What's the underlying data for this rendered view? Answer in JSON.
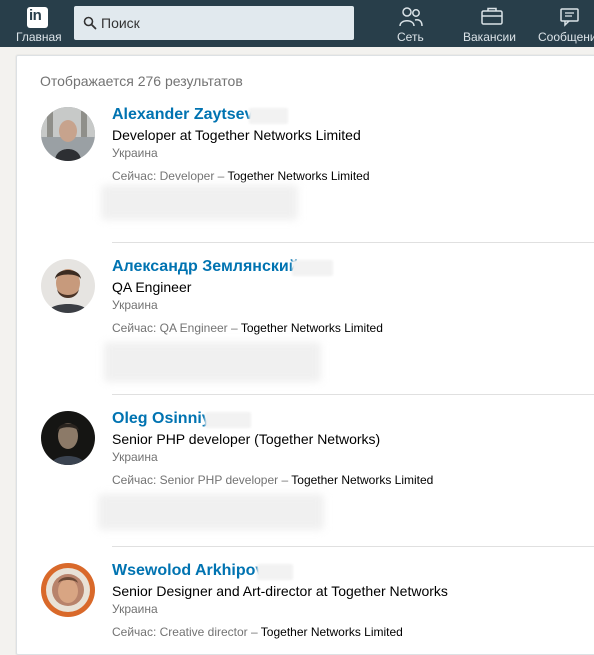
{
  "nav": {
    "home_label": "Главная",
    "network_label": "Сеть",
    "jobs_label": "Вакансии",
    "messages_label": "Сообщения",
    "logo_text": "in"
  },
  "search": {
    "placeholder": "Поиск",
    "value": ""
  },
  "results": {
    "count_text": "Отображается 276 результатов",
    "items": [
      {
        "name": "Alexander Zaytsev",
        "title": "Developer at Together Networks Limited",
        "location": "Украина",
        "current_prefix": "Сейчас: Developer – ",
        "current_company": "Together Networks Limited"
      },
      {
        "name": "Александр Землянский",
        "title": "QA Engineer",
        "location": "Украина",
        "current_prefix": "Сейчас: QA Engineer – ",
        "current_company": "Together Networks Limited"
      },
      {
        "name": "Oleg Osinniy",
        "title": "Senior PHP developer (Together Networks)",
        "location": "Украина",
        "current_prefix": "Сейчас: Senior PHP developer – ",
        "current_company": "Together Networks Limited"
      },
      {
        "name": "Wsewolod Arkhipov",
        "title": "Senior Designer and Art-director at Together Networks",
        "location": "Украина",
        "current_prefix": "Сейчас: Creative director – ",
        "current_company": "Together Networks Limited"
      }
    ]
  },
  "colors": {
    "topbar": "#283e4a",
    "link": "#0073b1",
    "muted": "#737373"
  },
  "icons": {
    "search": "search-icon",
    "network": "network-icon",
    "jobs": "briefcase-icon",
    "messages": "messages-icon",
    "home": "linkedin-logo-icon"
  }
}
